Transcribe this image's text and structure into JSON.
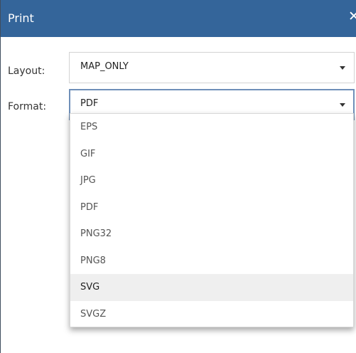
{
  "dialog": {
    "title": "Print"
  },
  "layout": {
    "label": "Layout:",
    "value": "MAP_ONLY"
  },
  "format": {
    "label": "Format:",
    "value": "PDF",
    "options": [
      "EPS",
      "GIF",
      "JPG",
      "PDF",
      "PNG32",
      "PNG8",
      "SVG",
      "SVGZ"
    ],
    "hovered_option": "SVG"
  },
  "icons": {
    "close": "close-icon",
    "caret": "chevron-down-icon"
  },
  "colors": {
    "titlebar": "#34659a",
    "focus_border": "#6f8fb8",
    "hover": "#efefef"
  }
}
